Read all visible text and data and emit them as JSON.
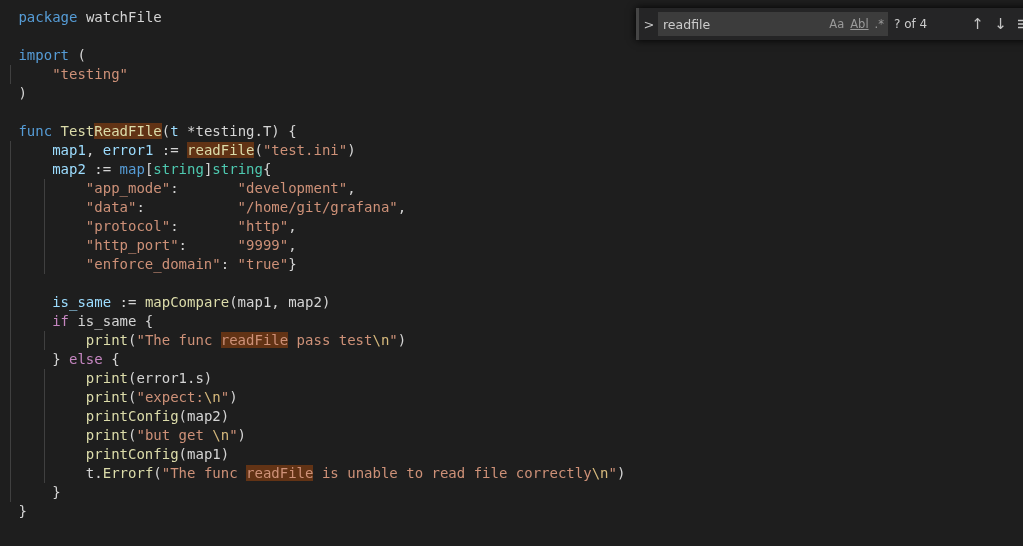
{
  "editor": {
    "lines": [
      {
        "kind": "code",
        "tokens": [
          {
            "kind": "kw",
            "text": "package",
            "match": false
          },
          {
            "kind": "plain",
            "text": " watchFile",
            "match": false
          }
        ]
      },
      {
        "kind": "blank"
      },
      {
        "kind": "code",
        "tokens": [
          {
            "kind": "kw",
            "text": "import",
            "match": false
          },
          {
            "kind": "plain",
            "text": " (",
            "match": false
          }
        ]
      },
      {
        "kind": "code",
        "tokens": [
          {
            "kind": "str",
            "text": "    \"testing\"",
            "match": false
          }
        ]
      },
      {
        "kind": "code",
        "tokens": [
          {
            "kind": "plain",
            "text": ")",
            "match": false
          }
        ]
      },
      {
        "kind": "blank"
      },
      {
        "kind": "code",
        "tokens": [
          {
            "kind": "kw",
            "text": "func",
            "match": false
          },
          {
            "kind": "fn",
            "text": " Test",
            "match": false
          },
          {
            "kind": "fn",
            "text": "ReadFIle",
            "match": true
          },
          {
            "kind": "plain",
            "text": "(",
            "match": false
          },
          {
            "kind": "var",
            "text": "t",
            "match": false
          },
          {
            "kind": "plain",
            "text": " *testing.T) {",
            "match": false
          }
        ]
      },
      {
        "kind": "code",
        "tokens": [
          {
            "kind": "var",
            "text": "    map1",
            "match": false
          },
          {
            "kind": "plain",
            "text": ", ",
            "match": false
          },
          {
            "kind": "var",
            "text": "error1",
            "match": false
          },
          {
            "kind": "plain",
            "text": " := ",
            "match": false
          },
          {
            "kind": "fn",
            "text": "readFile",
            "match": true
          },
          {
            "kind": "plain",
            "text": "(",
            "match": false
          },
          {
            "kind": "str",
            "text": "\"test.ini\"",
            "match": false
          },
          {
            "kind": "plain",
            "text": ")",
            "match": false
          }
        ]
      },
      {
        "kind": "code",
        "tokens": [
          {
            "kind": "var",
            "text": "    map2",
            "match": false
          },
          {
            "kind": "plain",
            "text": " := ",
            "match": false
          },
          {
            "kind": "kw",
            "text": "map",
            "match": false
          },
          {
            "kind": "plain",
            "text": "[",
            "match": false
          },
          {
            "kind": "type",
            "text": "string",
            "match": false
          },
          {
            "kind": "plain",
            "text": "]",
            "match": false
          },
          {
            "kind": "type",
            "text": "string",
            "match": false
          },
          {
            "kind": "plain",
            "text": "{",
            "match": false
          }
        ]
      },
      {
        "kind": "code",
        "tokens": [
          {
            "kind": "str",
            "text": "        \"app_mode\"",
            "match": false
          },
          {
            "kind": "plain",
            "text": ":       ",
            "match": false
          },
          {
            "kind": "str",
            "text": "\"development\"",
            "match": false
          },
          {
            "kind": "plain",
            "text": ",",
            "match": false
          }
        ]
      },
      {
        "kind": "code",
        "tokens": [
          {
            "kind": "str",
            "text": "        \"data\"",
            "match": false
          },
          {
            "kind": "plain",
            "text": ":           ",
            "match": false
          },
          {
            "kind": "str",
            "text": "\"/home/git/grafana\"",
            "match": false
          },
          {
            "kind": "plain",
            "text": ",",
            "match": false
          }
        ]
      },
      {
        "kind": "code",
        "tokens": [
          {
            "kind": "str",
            "text": "        \"protocol\"",
            "match": false
          },
          {
            "kind": "plain",
            "text": ":       ",
            "match": false
          },
          {
            "kind": "str",
            "text": "\"http\"",
            "match": false
          },
          {
            "kind": "plain",
            "text": ",",
            "match": false
          }
        ]
      },
      {
        "kind": "code",
        "tokens": [
          {
            "kind": "str",
            "text": "        \"http_port\"",
            "match": false
          },
          {
            "kind": "plain",
            "text": ":      ",
            "match": false
          },
          {
            "kind": "str",
            "text": "\"9999\"",
            "match": false
          },
          {
            "kind": "plain",
            "text": ",",
            "match": false
          }
        ]
      },
      {
        "kind": "code",
        "tokens": [
          {
            "kind": "str",
            "text": "        \"enforce_domain\"",
            "match": false
          },
          {
            "kind": "plain",
            "text": ": ",
            "match": false
          },
          {
            "kind": "str",
            "text": "\"true\"",
            "match": false
          },
          {
            "kind": "plain",
            "text": "}",
            "match": false
          }
        ]
      },
      {
        "kind": "blank"
      },
      {
        "kind": "code",
        "tokens": [
          {
            "kind": "var",
            "text": "    is_same",
            "match": false
          },
          {
            "kind": "plain",
            "text": " := ",
            "match": false
          },
          {
            "kind": "fn",
            "text": "mapCompare",
            "match": false
          },
          {
            "kind": "plain",
            "text": "(map1, map2)",
            "match": false
          }
        ]
      },
      {
        "kind": "code",
        "tokens": [
          {
            "kind": "ctl",
            "text": "    if",
            "match": false
          },
          {
            "kind": "plain",
            "text": " is_same {",
            "match": false
          }
        ]
      },
      {
        "kind": "code",
        "tokens": [
          {
            "kind": "fn",
            "text": "        print",
            "match": false
          },
          {
            "kind": "plain",
            "text": "(",
            "match": false
          },
          {
            "kind": "str",
            "text": "\"The func ",
            "match": false
          },
          {
            "kind": "str",
            "text": "readFile",
            "match": true
          },
          {
            "kind": "str",
            "text": " pass test",
            "match": false
          },
          {
            "kind": "esc",
            "text": "\\n",
            "match": false
          },
          {
            "kind": "str",
            "text": "\"",
            "match": false
          },
          {
            "kind": "plain",
            "text": ")",
            "match": false
          }
        ]
      },
      {
        "kind": "code",
        "tokens": [
          {
            "kind": "plain",
            "text": "    } ",
            "match": false
          },
          {
            "kind": "ctl",
            "text": "else",
            "match": false
          },
          {
            "kind": "plain",
            "text": " {",
            "match": false
          }
        ]
      },
      {
        "kind": "code",
        "tokens": [
          {
            "kind": "fn",
            "text": "        print",
            "match": false
          },
          {
            "kind": "plain",
            "text": "(error1.s)",
            "match": false
          }
        ]
      },
      {
        "kind": "code",
        "tokens": [
          {
            "kind": "fn",
            "text": "        print",
            "match": false
          },
          {
            "kind": "plain",
            "text": "(",
            "match": false
          },
          {
            "kind": "str",
            "text": "\"expect:",
            "match": false
          },
          {
            "kind": "esc",
            "text": "\\n",
            "match": false
          },
          {
            "kind": "str",
            "text": "\"",
            "match": false
          },
          {
            "kind": "plain",
            "text": ")",
            "match": false
          }
        ]
      },
      {
        "kind": "code",
        "tokens": [
          {
            "kind": "fn",
            "text": "        printConfig",
            "match": false
          },
          {
            "kind": "plain",
            "text": "(map2)",
            "match": false
          }
        ]
      },
      {
        "kind": "code",
        "tokens": [
          {
            "kind": "fn",
            "text": "        print",
            "match": false
          },
          {
            "kind": "plain",
            "text": "(",
            "match": false
          },
          {
            "kind": "str",
            "text": "\"but get ",
            "match": false
          },
          {
            "kind": "esc",
            "text": "\\n",
            "match": false
          },
          {
            "kind": "str",
            "text": "\"",
            "match": false
          },
          {
            "kind": "plain",
            "text": ")",
            "match": false
          }
        ]
      },
      {
        "kind": "code",
        "tokens": [
          {
            "kind": "fn",
            "text": "        printConfig",
            "match": false
          },
          {
            "kind": "plain",
            "text": "(map1)",
            "match": false
          }
        ]
      },
      {
        "kind": "code",
        "tokens": [
          {
            "kind": "plain",
            "text": "        t.",
            "match": false
          },
          {
            "kind": "fn",
            "text": "Errorf",
            "match": false
          },
          {
            "kind": "plain",
            "text": "(",
            "match": false
          },
          {
            "kind": "str",
            "text": "\"The func ",
            "match": false
          },
          {
            "kind": "str",
            "text": "readFile",
            "match": true
          },
          {
            "kind": "str",
            "text": " is unable to read file correctly",
            "match": false
          },
          {
            "kind": "esc",
            "text": "\\n",
            "match": false
          },
          {
            "kind": "str",
            "text": "\"",
            "match": false
          },
          {
            "kind": "plain",
            "text": ")",
            "match": false
          }
        ]
      },
      {
        "kind": "code",
        "tokens": [
          {
            "kind": "plain",
            "text": "    }",
            "match": false
          }
        ]
      },
      {
        "kind": "code",
        "tokens": [
          {
            "kind": "plain",
            "text": "}",
            "match": false
          }
        ]
      }
    ]
  },
  "find_widget": {
    "toggle": ">",
    "query": "readfile",
    "options": [
      "Aa",
      "Abl",
      ".*"
    ],
    "result": "? of 4",
    "previous": "↑",
    "next": "↓"
  }
}
